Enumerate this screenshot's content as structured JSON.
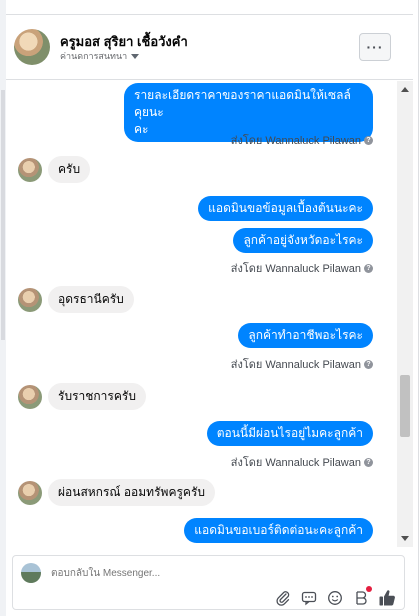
{
  "header": {
    "name": "ครูมอส สุริยา เชื้อวังคำ",
    "subtitle": "ค่านดการสนทนา",
    "more_label": "···"
  },
  "messages": [
    {
      "type": "out",
      "lines": [
        "รายละเอียดราคาของราคาแอดมินให้เซลล์คุยนะ",
        "คะ"
      ]
    },
    {
      "type": "sent_by",
      "text": "ส่งโดย Wannaluck Pilawan"
    },
    {
      "type": "in",
      "text": "ครับ"
    },
    {
      "type": "out",
      "lines": [
        "แอดมินขอข้อมูลเบื้องต้นนะคะ"
      ]
    },
    {
      "type": "out",
      "lines": [
        "ลูกค้าอยู่จังหวัดอะไรคะ"
      ]
    },
    {
      "type": "sent_by",
      "text": "ส่งโดย Wannaluck Pilawan"
    },
    {
      "type": "in",
      "text": "อุดรธานีครับ"
    },
    {
      "type": "out",
      "lines": [
        "ลูกค้าทำอาชีพอะไรคะ"
      ]
    },
    {
      "type": "sent_by",
      "text": "ส่งโดย Wannaluck Pilawan"
    },
    {
      "type": "in",
      "text": "รับราชการครับ"
    },
    {
      "type": "out",
      "lines": [
        "ตอนนี้มีผ่อนไรอยู่ไมคะลูกค้า"
      ]
    },
    {
      "type": "sent_by",
      "text": "ส่งโดย Wannaluck Pilawan"
    },
    {
      "type": "in",
      "text": "ผ่อนสหกรณ์ ออมทรัพครูครับ"
    },
    {
      "type": "out",
      "lines": [
        "แอดมินขอเบอร์ติดต่อนะคะลูกค้า"
      ]
    }
  ],
  "composer": {
    "placeholder": "ตอบกลับใน Messenger..."
  },
  "colors": {
    "outgoing_bubble": "#0084ff",
    "incoming_bubble": "#f1f0f0",
    "like_icon": "#4b4f56",
    "notification_dot": "#e41e3f"
  },
  "icons": [
    "attachment-icon",
    "gif-icon",
    "emoji-icon",
    "sticker-icon",
    "like-icon"
  ]
}
